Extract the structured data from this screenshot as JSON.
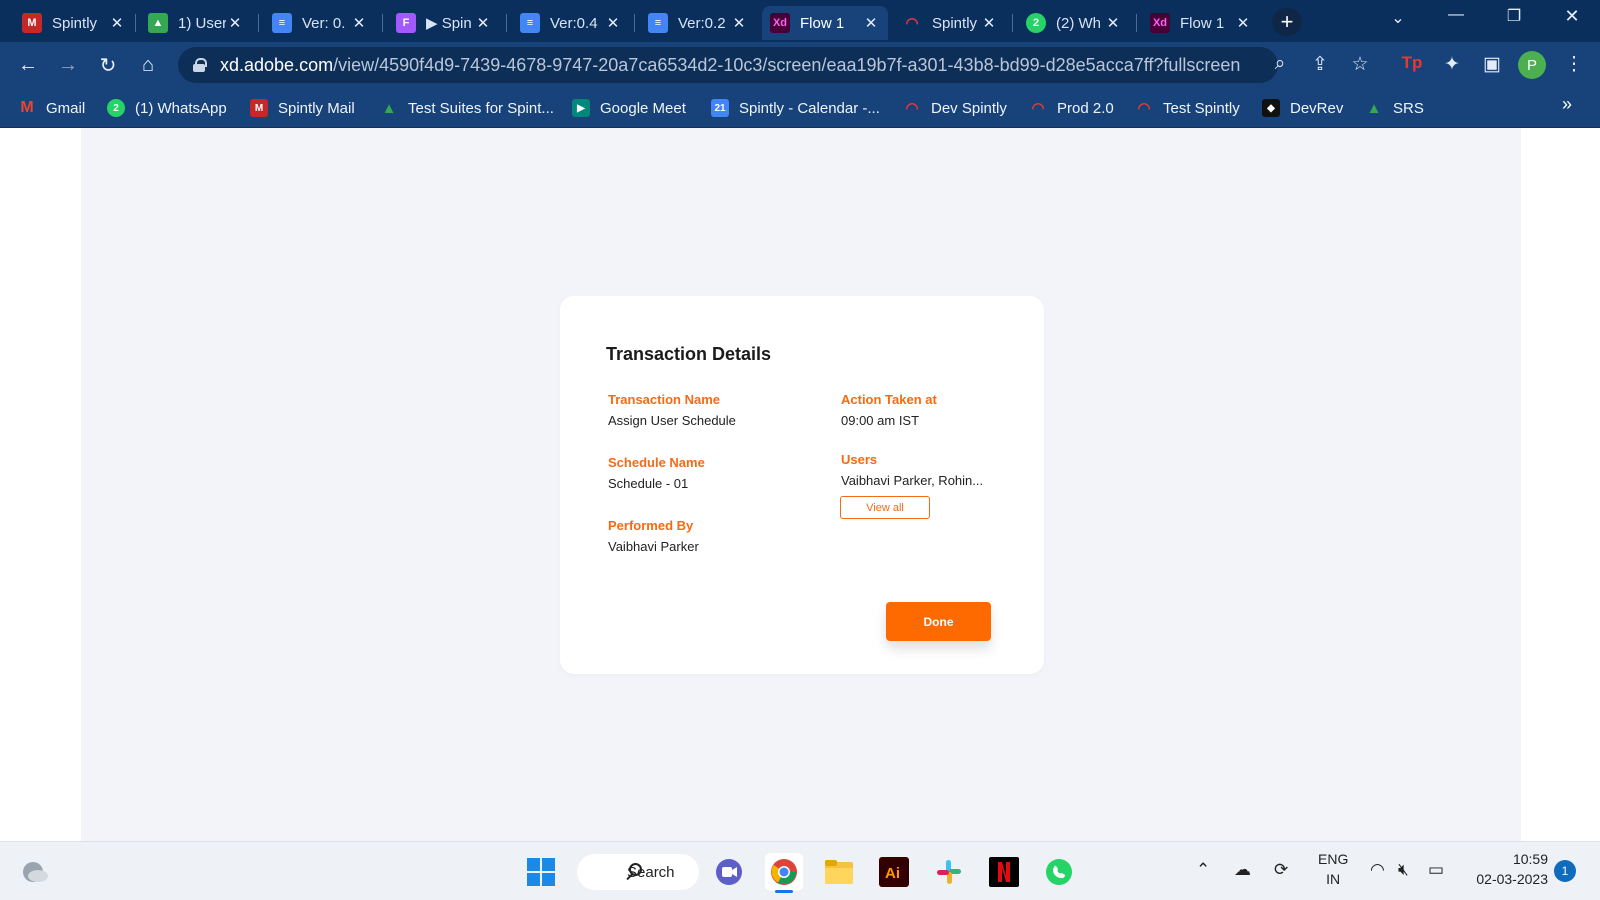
{
  "browser": {
    "tabs": [
      {
        "title": "Spintly",
        "icon": "spintly-mail-icon",
        "color": "#c62828"
      },
      {
        "title": "1) User",
        "icon": "google-drive-icon",
        "color": "#34a853"
      },
      {
        "title": "Ver: 0.",
        "icon": "google-docs-icon",
        "color": "#4285f4"
      },
      {
        "title": "▶ Spin",
        "icon": "figma-icon",
        "color": "#a259ff"
      },
      {
        "title": "Ver:0.4",
        "icon": "google-docs-icon",
        "color": "#4285f4"
      },
      {
        "title": "Ver:0.2",
        "icon": "google-docs-icon",
        "color": "#4285f4"
      },
      {
        "title": "Flow 1",
        "icon": "adobe-xd-icon",
        "color": "#470137",
        "active": true
      },
      {
        "title": "Spintly",
        "icon": "wifi-icon",
        "color": "#e53935"
      },
      {
        "title": "(2) Wh",
        "icon": "whatsapp-icon",
        "color": "#25d366"
      },
      {
        "title": "Flow 1",
        "icon": "adobe-xd-icon",
        "color": "#470137"
      }
    ],
    "url_domain": "xd.adobe.com",
    "url_path": "/view/4590f4d9-7439-4678-9747-20a7ca6534d2-10c3/screen/eaa19b7f-a301-43b8-bd99-d28e5acca7ff?fullscreen",
    "profile_initial": "P",
    "bookmarks": [
      {
        "label": "Gmail",
        "icon": "gmail-icon",
        "color": "#ea4335"
      },
      {
        "label": "(1) WhatsApp",
        "icon": "whatsapp-icon",
        "color": "#25d366"
      },
      {
        "label": "Spintly Mail",
        "icon": "spintly-mail-icon",
        "color": "#c62828"
      },
      {
        "label": "Test Suites for Spint...",
        "icon": "google-drive-icon",
        "color": "#34a853"
      },
      {
        "label": "Google Meet",
        "icon": "google-meet-icon",
        "color": "#00897b"
      },
      {
        "label": "Spintly - Calendar -...",
        "icon": "calendar-icon",
        "color": "#4285f4"
      },
      {
        "label": "Dev Spintly",
        "icon": "wifi-icon",
        "color": "#e53935"
      },
      {
        "label": "Prod 2.0",
        "icon": "wifi-icon",
        "color": "#e53935"
      },
      {
        "label": "Test Spintly",
        "icon": "wifi-icon",
        "color": "#e53935"
      },
      {
        "label": "DevRev",
        "icon": "devrev-icon",
        "color": "#111111"
      },
      {
        "label": "SRS",
        "icon": "google-drive-icon",
        "color": "#34a853"
      }
    ]
  },
  "dialog": {
    "title": "Transaction Details",
    "fields": {
      "transaction_name": {
        "label": "Transaction Name",
        "value": "Assign User Schedule"
      },
      "schedule_name": {
        "label": "Schedule Name",
        "value": "Schedule - 01"
      },
      "performed_by": {
        "label": "Performed By",
        "value": "Vaibhavi Parker"
      },
      "action_taken_at": {
        "label": "Action Taken at",
        "value": "09:00 am IST"
      },
      "users": {
        "label": "Users",
        "value": "Vaibhavi Parker, Rohin..."
      }
    },
    "view_all_label": "View all",
    "done_label": "Done",
    "accent_color": "#f56a14"
  },
  "taskbar": {
    "search_label": "Search",
    "language_line1": "ENG",
    "language_line2": "IN",
    "time": "10:59",
    "date": "02-03-2023",
    "notification_count": "1"
  }
}
